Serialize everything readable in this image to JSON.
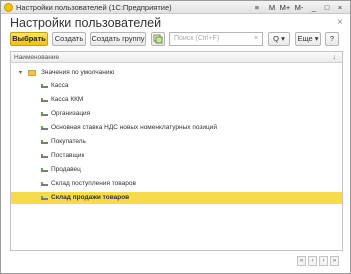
{
  "window": {
    "title": "Настройки пользователей  (1С:Предприятие)",
    "buttons": {
      "menu": "≡",
      "m": "M",
      "mplus": "M+",
      "mminus": "M-",
      "minimize": "_",
      "maximize": "□",
      "close": "×"
    }
  },
  "header": {
    "title": "Настройки пользователей",
    "close": "×"
  },
  "toolbar": {
    "select": "Выбрать",
    "create": "Создать",
    "create_group": "Создать группу",
    "search_placeholder": "Поиск (Ctrl+F)",
    "search_clear": "×",
    "find": "Q ▾",
    "more": "Еще ▾",
    "help": "?"
  },
  "table": {
    "column_header": "Наименование",
    "sort_indicator": "↓",
    "group": {
      "label": "Значения по умолчанию",
      "expander": "▾"
    },
    "rows": [
      {
        "label": "Касса"
      },
      {
        "label": "Касса ККМ"
      },
      {
        "label": "Организация"
      },
      {
        "label": "Основная ставка НДС новых номенклатурных позиций"
      },
      {
        "label": "Покупатель"
      },
      {
        "label": "Поставщик"
      },
      {
        "label": "Продавец"
      },
      {
        "label": "Склад поступления товаров"
      },
      {
        "label": "Склад продажи товаров",
        "selected": true
      }
    ]
  },
  "navigation": {
    "first": "«",
    "prev": "‹",
    "next": "›",
    "last": "»"
  }
}
